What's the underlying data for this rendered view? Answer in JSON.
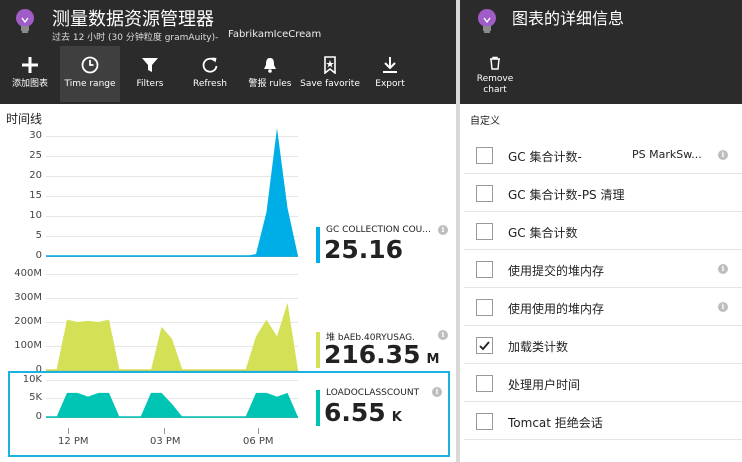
{
  "header": {
    "title": "测量数据资源管理器",
    "subtitle": "过去 12 小时 (30 分钟粒度 gramAuity)-",
    "resource": "FabrikamIceCream"
  },
  "toolbar": {
    "items": [
      {
        "label": "添加图表",
        "icon": "plus-icon"
      },
      {
        "label": "Time range",
        "icon": "clock-icon"
      },
      {
        "label": "Filters",
        "icon": "filter-icon"
      },
      {
        "label": "Refresh",
        "icon": "refresh-icon"
      },
      {
        "label": "警报 rules",
        "icon": "bell-icon"
      },
      {
        "label": "Save favorite",
        "icon": "bookmark-icon"
      },
      {
        "label": "Export",
        "icon": "download-icon"
      }
    ]
  },
  "details": {
    "title": "图表的详细信息",
    "remove_label": "Remove chart",
    "custom_label": "自定义"
  },
  "timeline": {
    "label": "时间线",
    "x_ticks": [
      "12 PM",
      "03 PM",
      "06 PM"
    ]
  },
  "colors": {
    "header_bg": "#2b2b2b",
    "series1": "#00aee7",
    "series2": "#d4e157",
    "series3": "#00c4b3",
    "selection": "#1ab3e0"
  },
  "metrics": [
    {
      "name": "GC COLLECTION COU...",
      "value": "25.16",
      "unit": ""
    },
    {
      "name": "堆 bAEb.40RYUSAG.",
      "value": "216.35",
      "unit": "M"
    },
    {
      "name": "LOADOCLASSCOUNT",
      "value": "6.55",
      "unit": "K"
    }
  ],
  "chart_data": [
    {
      "type": "area",
      "y_ticks": [
        "30",
        "25",
        "20",
        "15",
        "10",
        "5",
        "0"
      ],
      "ylim": [
        0,
        30
      ],
      "x": [
        0,
        1,
        2,
        3,
        4,
        5,
        6,
        7,
        8,
        9,
        10,
        11,
        12,
        13,
        14,
        15,
        16,
        17,
        18,
        19,
        20,
        21,
        22,
        23,
        24
      ],
      "series": [
        {
          "values": [
            0,
            0,
            0,
            0,
            0,
            0,
            0,
            0,
            0,
            0,
            0,
            0,
            0,
            0,
            0,
            0,
            0,
            0,
            0,
            0,
            0.5,
            11,
            32,
            12,
            0
          ]
        }
      ]
    },
    {
      "type": "area",
      "y_ticks": [
        "400M",
        "300M",
        "200M",
        "100M",
        "0"
      ],
      "ylim": [
        0,
        400
      ],
      "x": [
        0,
        1,
        2,
        3,
        4,
        5,
        6,
        7,
        8,
        9,
        10,
        11,
        12,
        13,
        14,
        15,
        16,
        17,
        18,
        19,
        20,
        21,
        22,
        23,
        24
      ],
      "series": [
        {
          "values": [
            0,
            0,
            210,
            200,
            205,
            200,
            210,
            0,
            0,
            0,
            0,
            180,
            130,
            0,
            0,
            0,
            0,
            0,
            0,
            0,
            140,
            210,
            140,
            280,
            0
          ]
        }
      ]
    },
    {
      "type": "area",
      "y_ticks": [
        "10K",
        "5K",
        "0"
      ],
      "ylim": [
        0,
        10
      ],
      "x": [
        0,
        1,
        2,
        3,
        4,
        5,
        6,
        7,
        8,
        9,
        10,
        11,
        12,
        13,
        14,
        15,
        16,
        17,
        18,
        19,
        20,
        21,
        22,
        23,
        24
      ],
      "series": [
        {
          "values": [
            0,
            0,
            6.5,
            6.5,
            5.5,
            6.5,
            6.5,
            0,
            0,
            0,
            6.5,
            6.5,
            3.5,
            0,
            0,
            0,
            0,
            0,
            0,
            0,
            6.5,
            6.5,
            5.5,
            6.5,
            0
          ]
        }
      ]
    }
  ],
  "metric_list": [
    {
      "label": "GC 集合计数-",
      "label2": "PS MarkSw...",
      "checked": false
    },
    {
      "label": "GC 集合计数-PS 清理",
      "label2": "",
      "checked": false
    },
    {
      "label": "GC 集合计数",
      "label2": "",
      "checked": false
    },
    {
      "label": "使用提交的堆内存",
      "label2": "",
      "checked": false
    },
    {
      "label": "使用使用的堆内存",
      "label2": "",
      "checked": false
    },
    {
      "label": "加载类计数",
      "label2": "",
      "checked": true
    },
    {
      "label": "处理用户时间",
      "label2": "",
      "checked": false
    },
    {
      "label": "Tomcat 拒绝会话",
      "label2": "",
      "checked": false
    }
  ]
}
